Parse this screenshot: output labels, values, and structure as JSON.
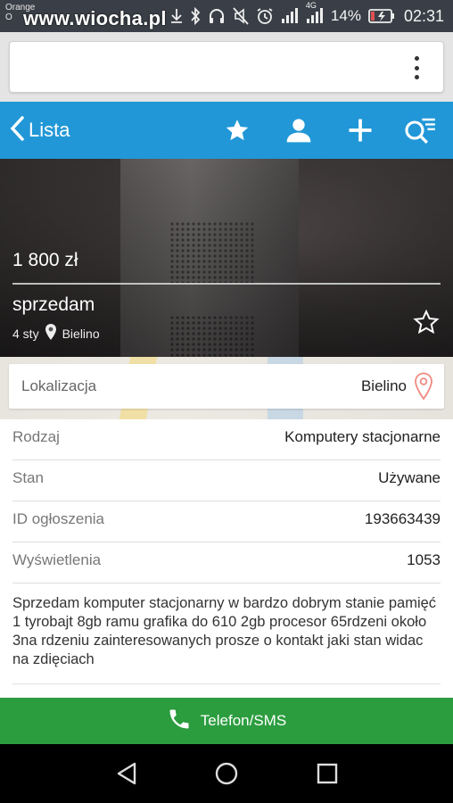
{
  "status_bar": {
    "carrier_line1": "Orange",
    "carrier_line2": "O",
    "watermark": "www.wiocha.pl",
    "network": "4G",
    "battery": "14%",
    "time": "02:31",
    "icons": [
      "bluetooth-icon",
      "headphones-icon",
      "mute-icon",
      "alarm-icon",
      "signal-icon",
      "wifi-icon",
      "battery-charging-icon"
    ]
  },
  "browser": {
    "url": "",
    "menu_icon": "kebab-menu-icon"
  },
  "app_header": {
    "back_label": "Lista",
    "icons": [
      "star-icon",
      "user-icon",
      "plus-icon",
      "search-list-icon"
    ],
    "color": "#2197d7"
  },
  "listing": {
    "price": "1 800 zł",
    "title": "sprzedam",
    "date": "4 sty",
    "location": "Bielino"
  },
  "location_card": {
    "label": "Lokalizacja",
    "value": "Bielino"
  },
  "details": [
    {
      "key": "Rodzaj",
      "value": "Komputery stacjonarne"
    },
    {
      "key": "Stan",
      "value": "Używane"
    },
    {
      "key": "ID ogłoszenia",
      "value": "193663439"
    },
    {
      "key": "Wyświetlenia",
      "value": "1053"
    }
  ],
  "description": "Sprzedam komputer stacjonarny w bardzo dobrym stanie pamięć 1 tyrobajt 8gb ramu grafika do 610 2gb procesor 65rdzeni około 3na rdzeniu zainteresowanych prosze o kontakt jaki stan widac na zdięciach",
  "call_bar": {
    "label": "Telefon/SMS",
    "color": "#2c9d3f"
  },
  "nav_bar": {
    "buttons": [
      "back-triangle-icon",
      "home-circle-icon",
      "recents-square-icon"
    ]
  }
}
